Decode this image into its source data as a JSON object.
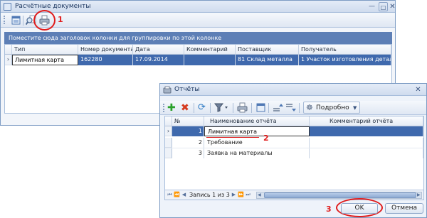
{
  "documents_window": {
    "title": "Расчётные документы",
    "toolbar": {
      "callout_number": "1"
    },
    "group_panel_text": "Поместите сюда заголовок колонки для группировки по этой колонке",
    "columns": [
      "Тип",
      "Номер документа",
      "Дата",
      "Комментарий",
      "Поставщик",
      "Получатель"
    ],
    "rows": [
      {
        "type": "Лимитная карта",
        "number": "162280",
        "date": "17.09.2014",
        "comment": "",
        "supplier": "81 Склад металла",
        "recipient": "1 Участок изготовления деталей"
      }
    ]
  },
  "reports_window": {
    "title": "Отчёты",
    "toolbar": {
      "view_label": "Подробно"
    },
    "columns": [
      "№",
      "Наименование отчёта",
      "Комментарий отчёта"
    ],
    "rows": [
      {
        "num": "1",
        "name": "Лимитная карта",
        "comment": ""
      },
      {
        "num": "2",
        "name": "Требование",
        "comment": ""
      },
      {
        "num": "3",
        "name": "Заявка на материалы",
        "comment": ""
      }
    ],
    "callout_number_row": "2",
    "navigator": {
      "record_text": "Запись 1 из 3"
    },
    "ok_label": "OK",
    "cancel_label": "Отмена",
    "callout_number_ok": "3"
  },
  "colors": {
    "selection": "#3f69ad",
    "group_panel": "#5d7fb6",
    "callout": "#e01c1c",
    "border": "#7d9cc4"
  }
}
